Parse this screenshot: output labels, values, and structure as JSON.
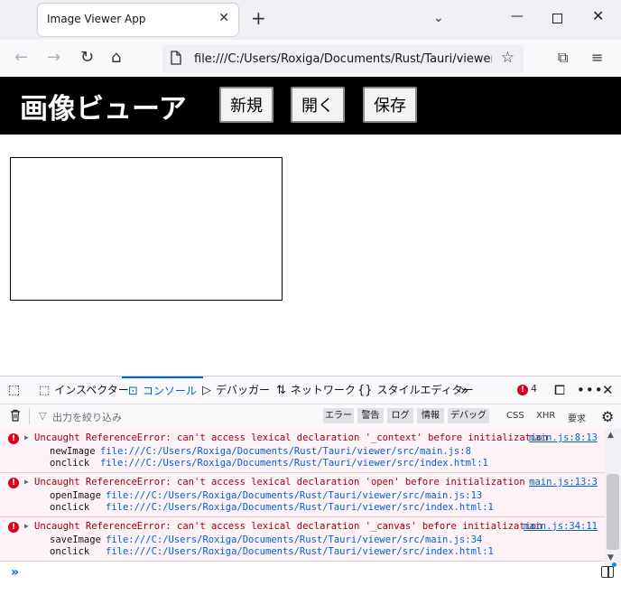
{
  "browser": {
    "tab_title": "Image Viewer App",
    "url": "file:///C:/Users/Roxiga/Documents/Rust/Tauri/viewer/src/index.html"
  },
  "app": {
    "title": "画像ビューア",
    "buttons": [
      "新規",
      "開く",
      "保存"
    ]
  },
  "devtools": {
    "tabs": [
      {
        "label": "インスペクター",
        "icon": "inspector-icon"
      },
      {
        "label": "コンソール",
        "icon": "console-icon",
        "active": true
      },
      {
        "label": "デバッガー",
        "icon": "debugger-icon"
      },
      {
        "label": "ネットワーク",
        "icon": "network-icon"
      },
      {
        "label": "スタイルエディター",
        "icon": "style-editor-icon"
      }
    ],
    "error_count": "4",
    "filter_placeholder": "出力を絞り込み",
    "levels": [
      "エラー",
      "警告",
      "ログ",
      "情報",
      "デバッグ"
    ],
    "types": [
      "CSS",
      "XHR",
      "要求"
    ],
    "messages": [
      {
        "text": "Uncaught ReferenceError: can't access lexical declaration '_context' before initialization",
        "location": "main.js:8:13",
        "stack": [
          {
            "fn": "newImage",
            "src": "file:///C:/Users/Roxiga/Documents/Rust/Tauri/viewer/src/main.js:8"
          },
          {
            "fn": "onclick",
            "src": "file:///C:/Users/Roxiga/Documents/Rust/Tauri/viewer/src/index.html:1"
          }
        ]
      },
      {
        "text": "Uncaught ReferenceError: can't access lexical declaration 'open' before initialization",
        "location": "main.js:13:3",
        "stack": [
          {
            "fn": "openImage",
            "src": "file:///C:/Users/Roxiga/Documents/Rust/Tauri/viewer/src/main.js:13"
          },
          {
            "fn": "onclick",
            "src": "file:///C:/Users/Roxiga/Documents/Rust/Tauri/viewer/src/index.html:1"
          }
        ]
      },
      {
        "text": "Uncaught ReferenceError: can't access lexical declaration '_canvas' before initialization",
        "location": "main.js:34:11",
        "stack": [
          {
            "fn": "saveImage",
            "src": "file:///C:/Users/Roxiga/Documents/Rust/Tauri/viewer/src/main.js:34"
          },
          {
            "fn": "onclick",
            "src": "file:///C:/Users/Roxiga/Documents/Rust/Tauri/viewer/src/index.html:1"
          }
        ]
      }
    ],
    "prompt_symbol": "»"
  },
  "colors": {
    "accent": "#0061e0",
    "error": "#d70022",
    "error_text": "#a4000f",
    "error_bg": "#fdf2f5",
    "app_header_bg": "#000000"
  }
}
